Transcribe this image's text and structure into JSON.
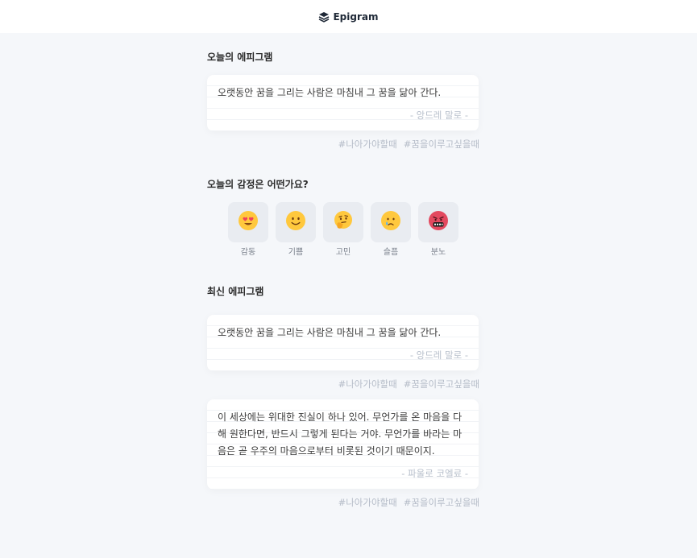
{
  "header": {
    "logo_text": "Epigram"
  },
  "today": {
    "title": "오늘의 에피그램",
    "quote": "오랫동안 꿈을 그리는 사람은 마침내 그 꿈을 닮아 간다.",
    "author": "- 앙드레 말로 -",
    "tags": [
      "#나아가야할때",
      "#꿈을이루고싶을때"
    ]
  },
  "emotion_section": {
    "title": "오늘의 감정은 어떤가요?",
    "items": [
      {
        "label": "감동",
        "icon": "heart-eyes-face-icon"
      },
      {
        "label": "기쁨",
        "icon": "smiling-face-icon"
      },
      {
        "label": "고민",
        "icon": "thinking-face-icon"
      },
      {
        "label": "슬픔",
        "icon": "sad-tear-face-icon"
      },
      {
        "label": "분노",
        "icon": "angry-face-icon"
      }
    ]
  },
  "recent": {
    "title": "최신 에피그램",
    "cards": [
      {
        "quote": "오랫동안 꿈을 그리는 사람은 마침내 그 꿈을 닮아 간다.",
        "author": "- 앙드레 말로 -",
        "tags": [
          "#나아가야할때",
          "#꿈을이루고싶을때"
        ]
      },
      {
        "quote": "이 세상에는 위대한 진실이 하나 있어. 무언가를 온 마음을 다해 원한다면, 반드시 그렇게 된다는 거야. 무언가를 바라는 마음은 곧 우주의 마음으로부터 비롯된 것이기 때문이지.",
        "author": "- 파울로 코엘료 -",
        "tags": [
          "#나아가야할때",
          "#꿈을이루고싶을때"
        ]
      }
    ]
  }
}
